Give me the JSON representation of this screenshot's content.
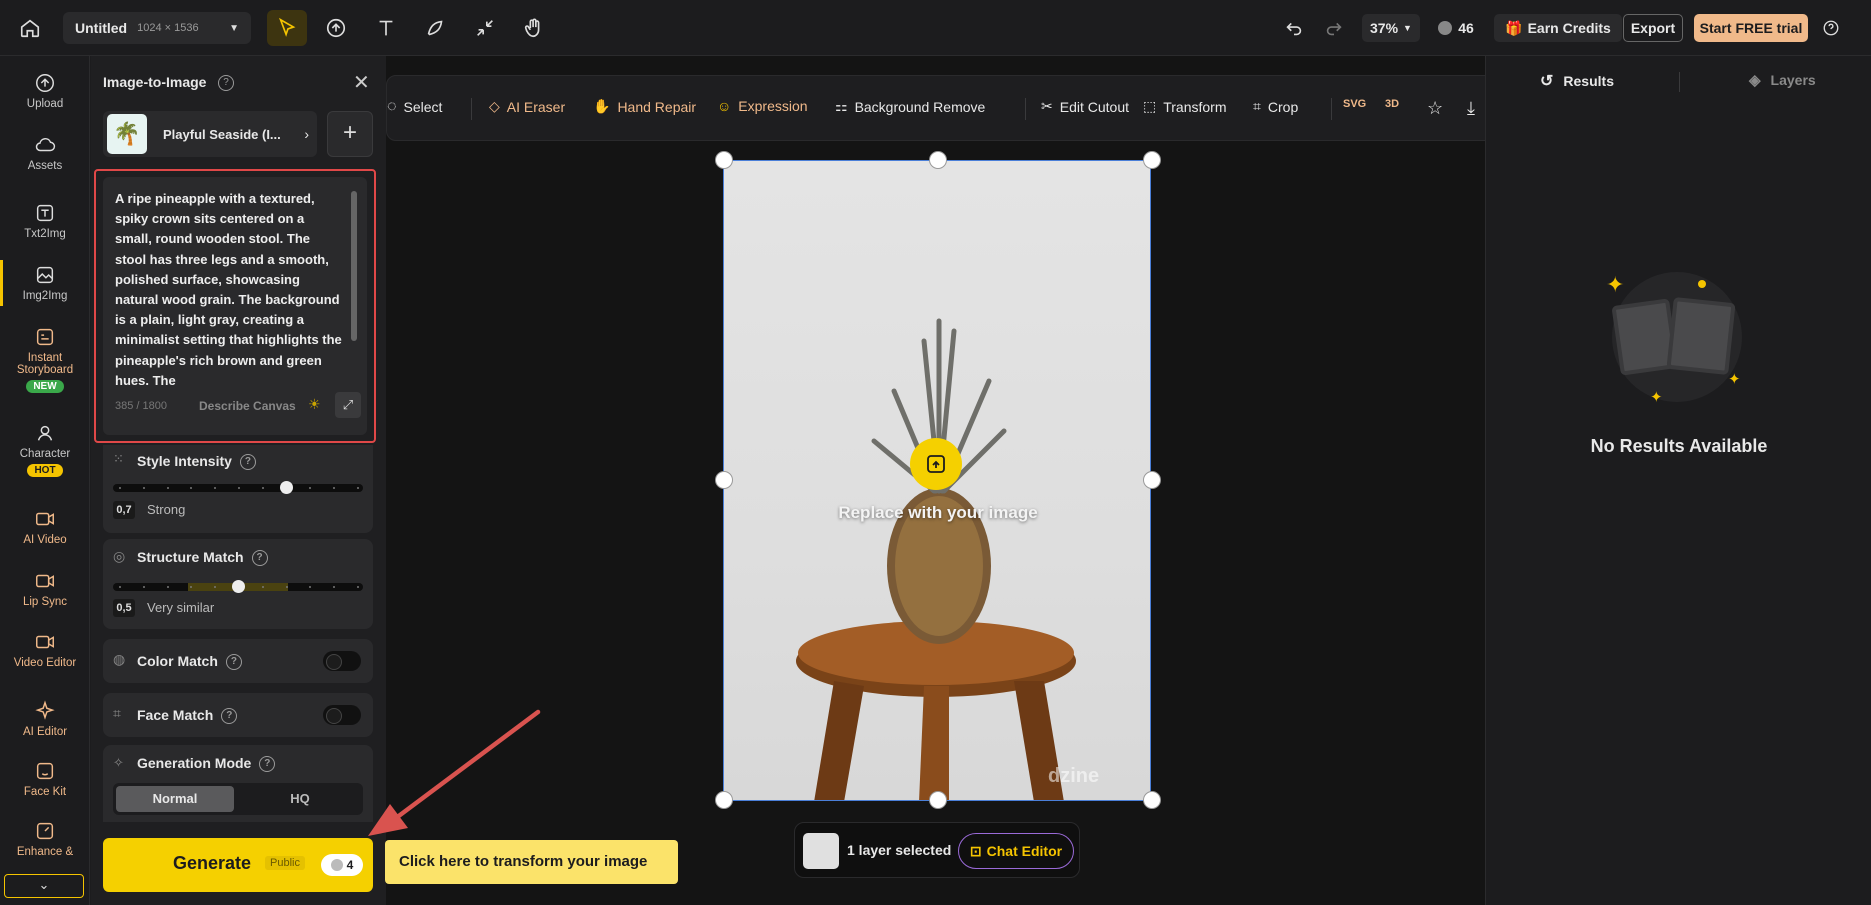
{
  "topbar": {
    "doc_title": "Untitled",
    "doc_size": "1024 × 1536",
    "zoom": "37%",
    "credits": "46",
    "earn_credits": "Earn Credits",
    "export": "Export",
    "trial_prefix": "Start ",
    "trial_free": "FREE",
    "trial_suffix": " trial"
  },
  "rail": {
    "upload": "Upload",
    "assets": "Assets",
    "txt2img": "Txt2Img",
    "img2img": "Img2Img",
    "storyboard_1": "Instant",
    "storyboard_2": "Storyboard",
    "storyboard_badge": "NEW",
    "character": "Character",
    "character_badge": "HOT",
    "ai_video": "AI Video",
    "lip_sync": "Lip Sync",
    "video_editor": "Video Editor",
    "ai_editor": "AI Editor",
    "face_kit": "Face Kit",
    "enhance": "Enhance &"
  },
  "panel": {
    "title": "Image-to-Image",
    "style_name": "Playful Seaside (I...",
    "prompt": "A ripe pineapple with a textured, spiky crown sits centered on a small, round wooden stool. The stool has three legs and a smooth, polished surface, showcasing natural wood grain. The background is a plain, light gray, creating a minimalist setting that highlights the pineapple's rich brown and green hues. The",
    "char_count": "385 / 1800",
    "describe_canvas": "Describe Canvas",
    "style_intensity_label": "Style Intensity",
    "style_intensity_value": "0,7",
    "style_intensity_text": "Strong",
    "style_intensity_level": 0.7,
    "structure_match_label": "Structure Match",
    "structure_match_value": "0,5",
    "structure_match_text": "Very similar",
    "structure_match_level": 0.5,
    "color_match_label": "Color Match",
    "face_match_label": "Face Match",
    "generation_mode_label": "Generation Mode",
    "mode_normal": "Normal",
    "mode_hq": "HQ",
    "generate": "Generate",
    "public_tag": "Public",
    "generate_cost": "4"
  },
  "tooltip": "Click here to transform your image",
  "edit_toolbar": {
    "select": "Select",
    "ai_eraser": "AI Eraser",
    "hand_repair": "Hand Repair",
    "expression": "Expression",
    "background_remove": "Background Remove",
    "edit_cutout": "Edit Cutout",
    "transform": "Transform",
    "crop": "Crop",
    "svg": "SVG",
    "three_d": "3D"
  },
  "canvas": {
    "replace_text": "Replace with your image",
    "watermark": "dzine",
    "layer_selected": "1 layer selected",
    "chat_editor": "Chat Editor"
  },
  "right": {
    "results_tab": "Results",
    "layers_tab": "Layers",
    "empty_text": "No Results Available"
  },
  "colors": {
    "accent": "#f5c400",
    "highlight_border": "#e04848",
    "arrow": "#d9534f",
    "trial_bg": "#f0b98a"
  }
}
